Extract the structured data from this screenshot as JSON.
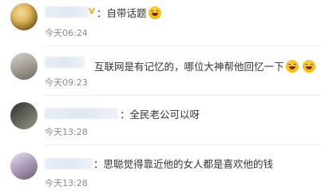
{
  "comments": [
    {
      "text": "：自带话题",
      "timestamp": "今天06:24",
      "has_vip_badge": true,
      "vip_badge": "V",
      "emojis": [
        "laughing-tears-emoji"
      ]
    },
    {
      "text": "互联网是有记忆的，哪位大神帮他回忆一下",
      "timestamp": "今天09:23",
      "has_vip_badge": false,
      "emojis": [
        "laughing-tears-emoji",
        "laughing-tears-emoji"
      ]
    },
    {
      "text": "：全民老公可以呀",
      "timestamp": "今天13:28",
      "has_vip_badge": false,
      "emojis": []
    },
    {
      "text": "：思聪觉得靠近他的女人都是喜欢他的钱",
      "timestamp": "今天13:28",
      "has_vip_badge": false,
      "emojis": []
    }
  ],
  "colors": {
    "text": "#333333",
    "timestamp": "#8a8a8a",
    "vip_badge": "#f0a400",
    "emoji": "#f6b800"
  }
}
